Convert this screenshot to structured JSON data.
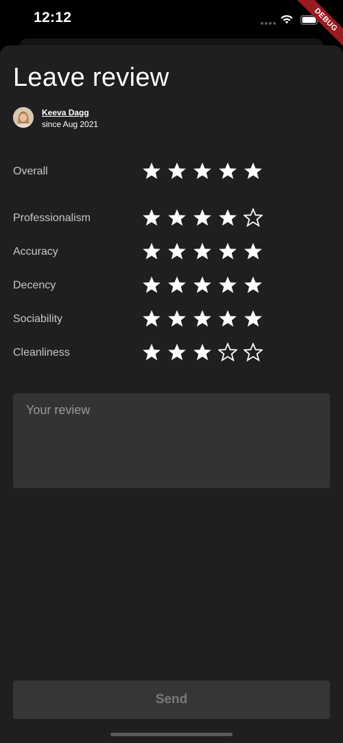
{
  "status_bar": {
    "time": "12:12",
    "debug_label": "DEBUG"
  },
  "page": {
    "title": "Leave review"
  },
  "reviewer": {
    "name": "Keeva Dagg",
    "since": "since Aug 2021"
  },
  "ratings": [
    {
      "label": "Overall",
      "value": 5,
      "max": 5
    },
    {
      "label": "Professionalism",
      "value": 4,
      "max": 5
    },
    {
      "label": "Accuracy",
      "value": 5,
      "max": 5
    },
    {
      "label": "Decency",
      "value": 5,
      "max": 5
    },
    {
      "label": "Sociability",
      "value": 5,
      "max": 5
    },
    {
      "label": "Cleanliness",
      "value": 3,
      "max": 5
    }
  ],
  "review": {
    "placeholder": "Your review",
    "value": ""
  },
  "actions": {
    "send_label": "Send"
  },
  "colors": {
    "background": "#000000",
    "sheet": "#1f1f21",
    "field": "#333335",
    "star": "#ffffff",
    "debug_banner": "#9a1b1f"
  }
}
